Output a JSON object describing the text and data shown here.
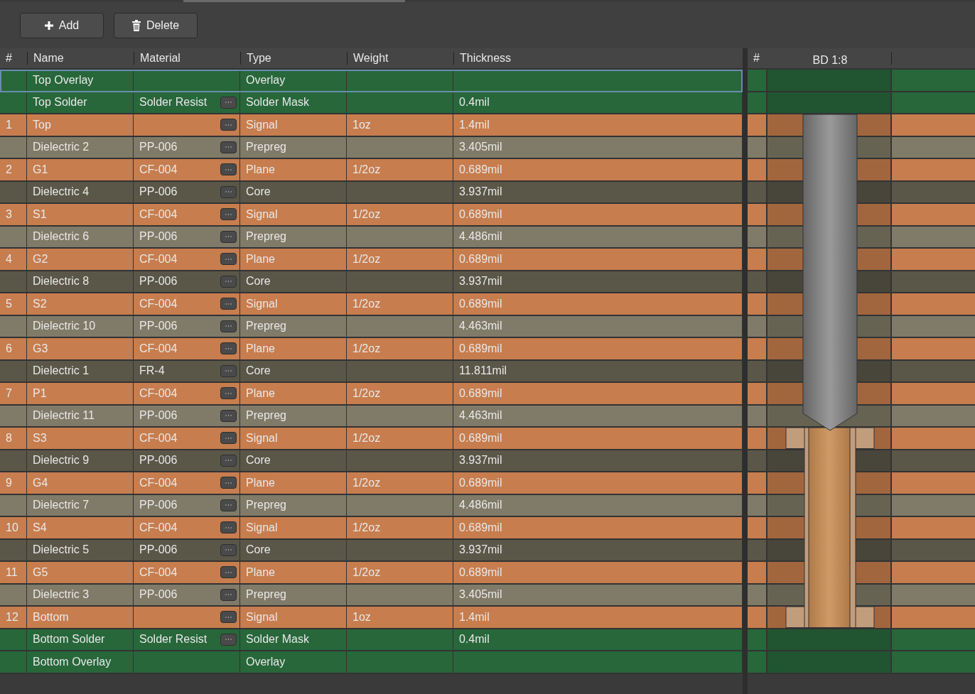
{
  "toolbar": {
    "buttons": [
      {
        "kind": "add",
        "label": "Add"
      },
      {
        "kind": "delete",
        "label": "Delete"
      }
    ]
  },
  "table": {
    "columns": [
      "#",
      "Name",
      "Material",
      "Type",
      "Weight",
      "Thickness"
    ],
    "rows": [
      {
        "kind": "mask",
        "name": "Top Overlay",
        "type": "Overlay",
        "picker": false,
        "selected": true
      },
      {
        "kind": "mask",
        "name": "Top Solder",
        "material": "Solder Resist",
        "type": "Solder Mask",
        "thickness": "0.4mil",
        "picker": true,
        "selected": false
      },
      {
        "kind": "copper",
        "number": "1",
        "name": "Top",
        "type": "Signal",
        "weight": "1oz",
        "thickness": "1.4mil",
        "picker": true,
        "selected": false
      },
      {
        "kind": "prepreg",
        "name": "Dielectric 2",
        "material": "PP-006",
        "type": "Prepreg",
        "thickness": "3.405mil",
        "picker": true,
        "selected": false
      },
      {
        "kind": "copper",
        "number": "2",
        "name": "G1",
        "material": "CF-004",
        "type": "Plane",
        "weight": "1/2oz",
        "thickness": "0.689mil",
        "picker": true,
        "selected": false
      },
      {
        "kind": "core",
        "name": "Dielectric 4",
        "material": "PP-006",
        "type": "Core",
        "thickness": "3.937mil",
        "picker": true,
        "selected": false
      },
      {
        "kind": "copper",
        "number": "3",
        "name": "S1",
        "material": "CF-004",
        "type": "Signal",
        "weight": "1/2oz",
        "thickness": "0.689mil",
        "picker": true,
        "selected": false
      },
      {
        "kind": "prepreg",
        "name": "Dielectric 6",
        "material": "PP-006",
        "type": "Prepreg",
        "thickness": "4.486mil",
        "picker": true,
        "selected": false
      },
      {
        "kind": "copper",
        "number": "4",
        "name": "G2",
        "material": "CF-004",
        "type": "Plane",
        "weight": "1/2oz",
        "thickness": "0.689mil",
        "picker": true,
        "selected": false
      },
      {
        "kind": "core",
        "name": "Dielectric 8",
        "material": "PP-006",
        "type": "Core",
        "thickness": "3.937mil",
        "picker": true,
        "selected": false
      },
      {
        "kind": "copper",
        "number": "5",
        "name": "S2",
        "material": "CF-004",
        "type": "Signal",
        "weight": "1/2oz",
        "thickness": "0.689mil",
        "picker": true,
        "selected": false
      },
      {
        "kind": "prepreg",
        "name": "Dielectric 10",
        "material": "PP-006",
        "type": "Prepreg",
        "thickness": "4.463mil",
        "picker": true,
        "selected": false
      },
      {
        "kind": "copper",
        "number": "6",
        "name": "G3",
        "material": "CF-004",
        "type": "Plane",
        "weight": "1/2oz",
        "thickness": "0.689mil",
        "picker": true,
        "selected": false
      },
      {
        "kind": "core",
        "name": "Dielectric 1",
        "material": "FR-4",
        "type": "Core",
        "thickness": "11.811mil",
        "picker": true,
        "selected": false
      },
      {
        "kind": "copper",
        "number": "7",
        "name": "P1",
        "material": "CF-004",
        "type": "Plane",
        "weight": "1/2oz",
        "thickness": "0.689mil",
        "picker": true,
        "selected": false
      },
      {
        "kind": "prepreg",
        "name": "Dielectric 11",
        "material": "PP-006",
        "type": "Prepreg",
        "thickness": "4.463mil",
        "picker": true,
        "selected": false
      },
      {
        "kind": "copper",
        "number": "8",
        "name": "S3",
        "material": "CF-004",
        "type": "Signal",
        "weight": "1/2oz",
        "thickness": "0.689mil",
        "picker": true,
        "selected": false
      },
      {
        "kind": "core",
        "name": "Dielectric 9",
        "material": "PP-006",
        "type": "Core",
        "thickness": "3.937mil",
        "picker": true,
        "selected": false
      },
      {
        "kind": "copper",
        "number": "9",
        "name": "G4",
        "material": "CF-004",
        "type": "Plane",
        "weight": "1/2oz",
        "thickness": "0.689mil",
        "picker": true,
        "selected": false
      },
      {
        "kind": "prepreg",
        "name": "Dielectric 7",
        "material": "PP-006",
        "type": "Prepreg",
        "thickness": "4.486mil",
        "picker": true,
        "selected": false
      },
      {
        "kind": "copper",
        "number": "10",
        "name": "S4",
        "material": "CF-004",
        "type": "Signal",
        "weight": "1/2oz",
        "thickness": "0.689mil",
        "picker": true,
        "selected": false
      },
      {
        "kind": "core",
        "name": "Dielectric 5",
        "material": "PP-006",
        "type": "Core",
        "thickness": "3.937mil",
        "picker": true,
        "selected": false
      },
      {
        "kind": "copper",
        "number": "11",
        "name": "G5",
        "material": "CF-004",
        "type": "Plane",
        "weight": "1/2oz",
        "thickness": "0.689mil",
        "picker": true,
        "selected": false
      },
      {
        "kind": "prepreg",
        "name": "Dielectric 3",
        "material": "PP-006",
        "type": "Prepreg",
        "thickness": "3.405mil",
        "picker": true,
        "selected": false
      },
      {
        "kind": "copper",
        "number": "12",
        "name": "Bottom",
        "type": "Signal",
        "weight": "1oz",
        "thickness": "1.4mil",
        "picker": true,
        "selected": false
      },
      {
        "kind": "mask",
        "name": "Bottom Solder",
        "material": "Solder Resist",
        "type": "Solder Mask",
        "thickness": "0.4mil",
        "picker": true,
        "selected": false
      },
      {
        "kind": "mask",
        "name": "Bottom Overlay",
        "type": "Overlay",
        "picker": false,
        "selected": false
      }
    ]
  },
  "preview": {
    "columns": [
      "#",
      "BD 1:8"
    ]
  }
}
